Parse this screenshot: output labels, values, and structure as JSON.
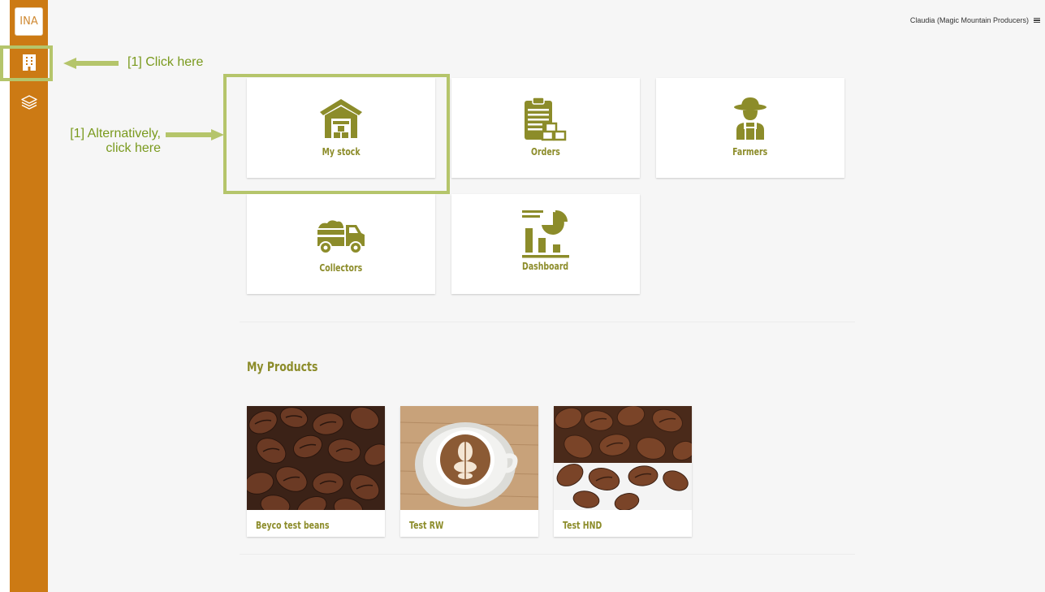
{
  "header": {
    "user_label": "Claudia (Magic Mountain Producers)"
  },
  "sidebar": {
    "logo_text": "INA",
    "items": [
      {
        "icon": "building-icon"
      },
      {
        "icon": "layers-icon"
      }
    ]
  },
  "tiles": [
    {
      "label": "My stock",
      "icon": "warehouse-icon"
    },
    {
      "label": "Orders",
      "icon": "clipboard-boxes-icon"
    },
    {
      "label": "Farmers",
      "icon": "farmer-icon"
    },
    {
      "label": "Collectors",
      "icon": "truck-icon"
    },
    {
      "label": "Dashboard",
      "icon": "dashboard-chart-icon"
    }
  ],
  "products": {
    "title": "My Products",
    "items": [
      {
        "label": "Beyco test beans",
        "image": "coffee-beans-image"
      },
      {
        "label": "Test RW",
        "image": "latte-cup-image"
      },
      {
        "label": "Test HND",
        "image": "coffee-beans-image"
      }
    ]
  },
  "annotations": {
    "click_here": "[1] Click here",
    "alternatively_line1": "[1] Alternatively,",
    "alternatively_line2": "click here"
  },
  "colors": {
    "sidebar": "#cc7a14",
    "accent": "#8c8c2a",
    "annotation": "#b5c56b",
    "background": "#f6f6f6"
  }
}
